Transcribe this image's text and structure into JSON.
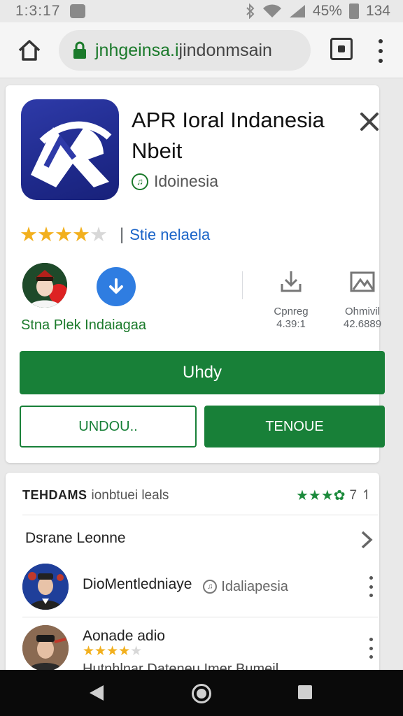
{
  "status_bar": {
    "time": "1:3:17",
    "battery": "45%",
    "right_value": "134"
  },
  "browser": {
    "url_host": "jnhgeinsa.i",
    "url_rest": "jindonmsain"
  },
  "app": {
    "title": "APR Ioral Indanesia Nbeit",
    "developer": "Idoinesia",
    "rating_stars": 4.5,
    "rating_link": "Stie nelaela",
    "publisher_label": "Stna Plek Indaiagaa",
    "meta_1_label": "Cpnreg",
    "meta_1_value": "4.39:1",
    "meta_2_label": "Ohmivil",
    "meta_2_value": "42.6889",
    "primary_button": "Uhdy",
    "outline_button": "UNDOU..",
    "solid_button": "TENOUE"
  },
  "reviews": {
    "title": "TEHDAMS",
    "subtitle": "ionbtuei leals",
    "rating_count": "7",
    "list_header": "Dsrane Leonne",
    "item1_name": "DioMentledniaye",
    "item1_dev": "Idaliapesia",
    "item2_name": "Aonade adio",
    "item2_stars": 4.5,
    "item2_text": "Hutnhlnar Dateneu Imer Bumeil"
  },
  "colors": {
    "accent_green": "#188038",
    "link_blue": "#1a64c8",
    "star_yellow": "#f2b01e",
    "icon_blue": "#2e3aa8"
  },
  "icons": [
    "home-icon",
    "lock-icon",
    "tabs-icon",
    "menu-icon",
    "close-icon",
    "download-icon",
    "bookmark-icon",
    "chevron-right-icon",
    "back-icon",
    "nav-home-icon",
    "recents-icon"
  ]
}
